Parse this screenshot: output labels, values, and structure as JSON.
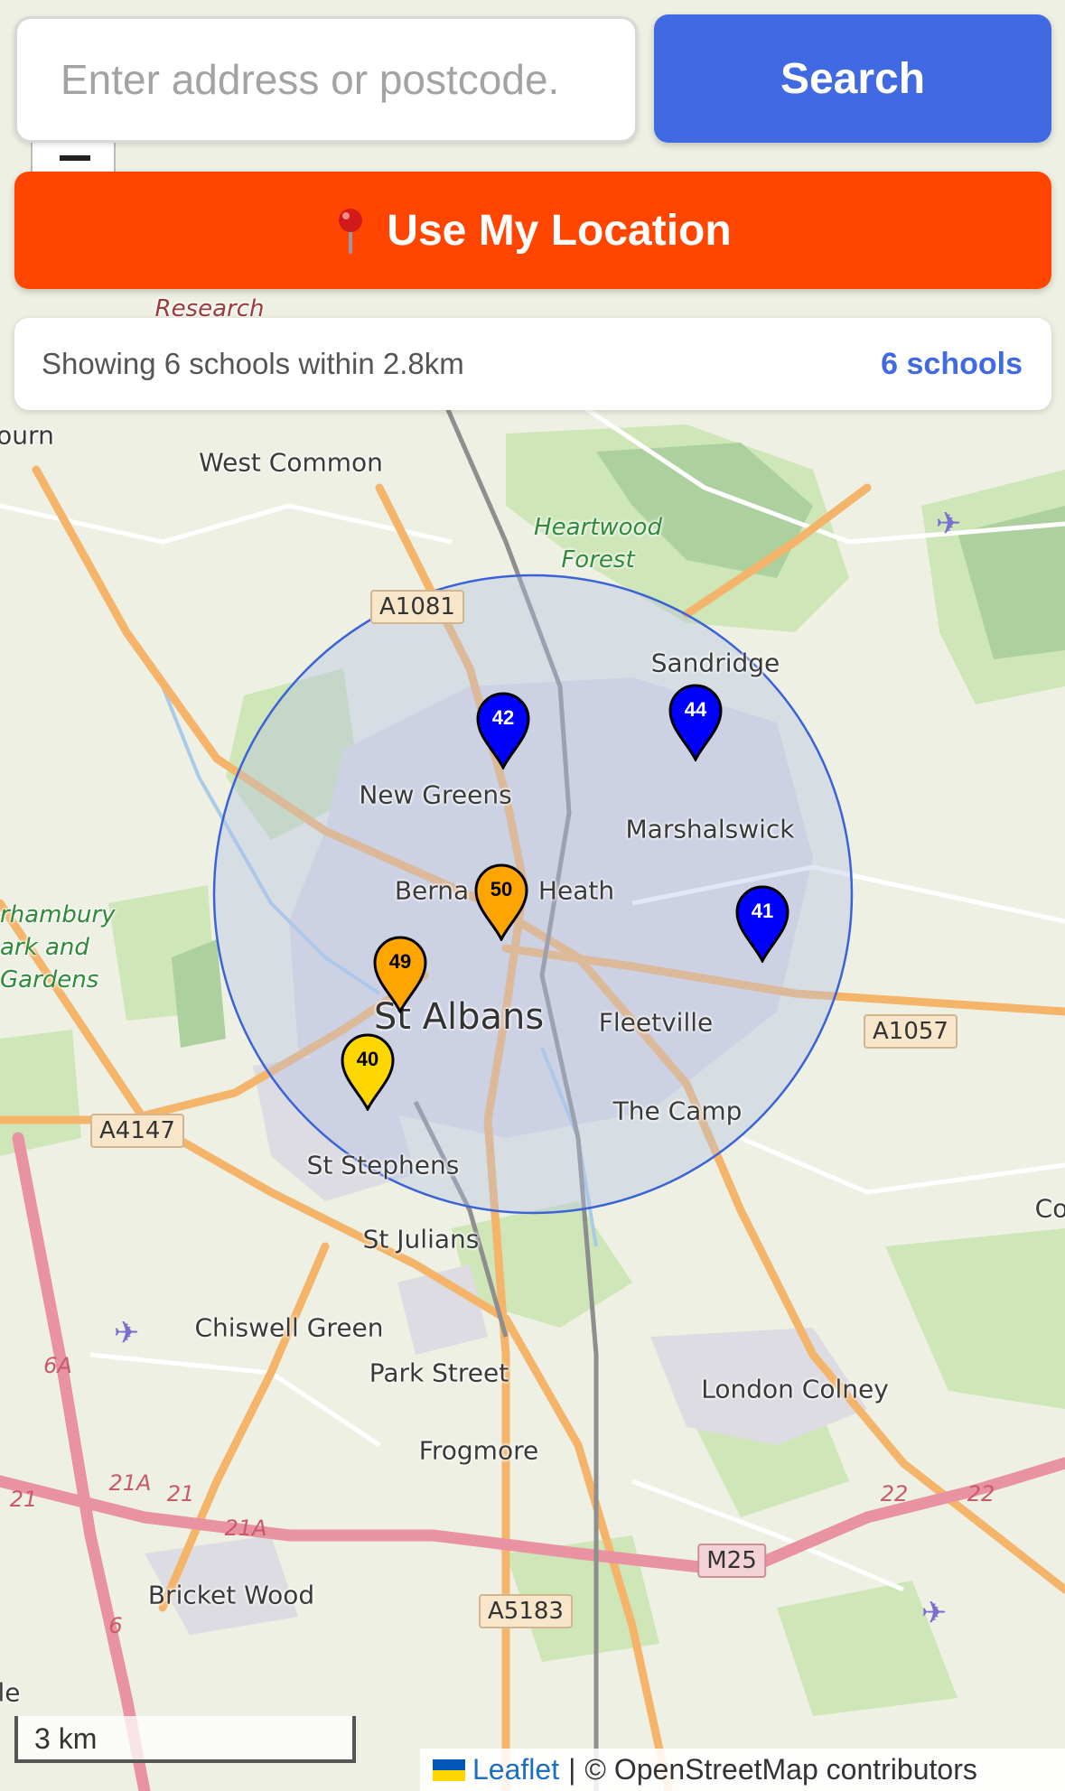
{
  "search": {
    "placeholder": "Enter address or postcode.",
    "button_label": "Search"
  },
  "location_button": {
    "label": "Use My Location",
    "icon": "pin-icon"
  },
  "status": {
    "text": "Showing 6 schools within 2.8km",
    "count": "6 schools"
  },
  "map": {
    "place_labels": [
      {
        "name": "Research",
        "kind": "research"
      },
      {
        "name": "ourn",
        "kind": "place"
      },
      {
        "name": "West Common",
        "kind": "place"
      },
      {
        "name": "Heartwood",
        "kind": "forest"
      },
      {
        "name": "Forest",
        "kind": "forest"
      },
      {
        "name": "Sandridge",
        "kind": "place"
      },
      {
        "name": "New Greens",
        "kind": "place"
      },
      {
        "name": "Marshalswick",
        "kind": "place"
      },
      {
        "name": "Berna",
        "kind": "place"
      },
      {
        "name": "Heath",
        "kind": "place"
      },
      {
        "name": "rhambury",
        "kind": "park"
      },
      {
        "name": "ark and",
        "kind": "park"
      },
      {
        "name": "Gardens",
        "kind": "park"
      },
      {
        "name": "St Albans",
        "kind": "big"
      },
      {
        "name": "Fleetville",
        "kind": "place"
      },
      {
        "name": "The Camp",
        "kind": "place"
      },
      {
        "name": "St Stephens",
        "kind": "place"
      },
      {
        "name": "St Julians",
        "kind": "place"
      },
      {
        "name": "Chiswell Green",
        "kind": "place"
      },
      {
        "name": "Park Street",
        "kind": "place"
      },
      {
        "name": "London Colney",
        "kind": "place"
      },
      {
        "name": "Frogmore",
        "kind": "place"
      },
      {
        "name": "Bricket Wood",
        "kind": "place"
      },
      {
        "name": "Co",
        "kind": "place"
      },
      {
        "name": "le",
        "kind": "place"
      }
    ],
    "road_shields": [
      {
        "label": "A1081",
        "type": "a-road"
      },
      {
        "label": "A1057",
        "type": "a-road"
      },
      {
        "label": "A4147",
        "type": "a-road"
      },
      {
        "label": "A5183",
        "type": "a-road"
      },
      {
        "label": "M25",
        "type": "motorway"
      }
    ],
    "junction_labels": [
      "6A",
      "21A",
      "21",
      "21",
      "21A",
      "22",
      "22",
      "6"
    ],
    "search_radius_km": 2.8,
    "colors": {
      "radius_stroke": "#3a63d6",
      "radius_fill": "#b3bfe6",
      "blue": "#0000ff",
      "orange": "#ffa500",
      "yellow": "#ffd700"
    },
    "schools": [
      {
        "score": "42",
        "color": "blue"
      },
      {
        "score": "44",
        "color": "blue"
      },
      {
        "score": "50",
        "color": "orange"
      },
      {
        "score": "41",
        "color": "blue"
      },
      {
        "score": "49",
        "color": "orange"
      },
      {
        "score": "40",
        "color": "yellow"
      }
    ]
  },
  "scale": {
    "label": "3 km"
  },
  "attribution": {
    "leaflet": "Leaflet",
    "separator": "|",
    "osm": "© OpenStreetMap contributors"
  }
}
